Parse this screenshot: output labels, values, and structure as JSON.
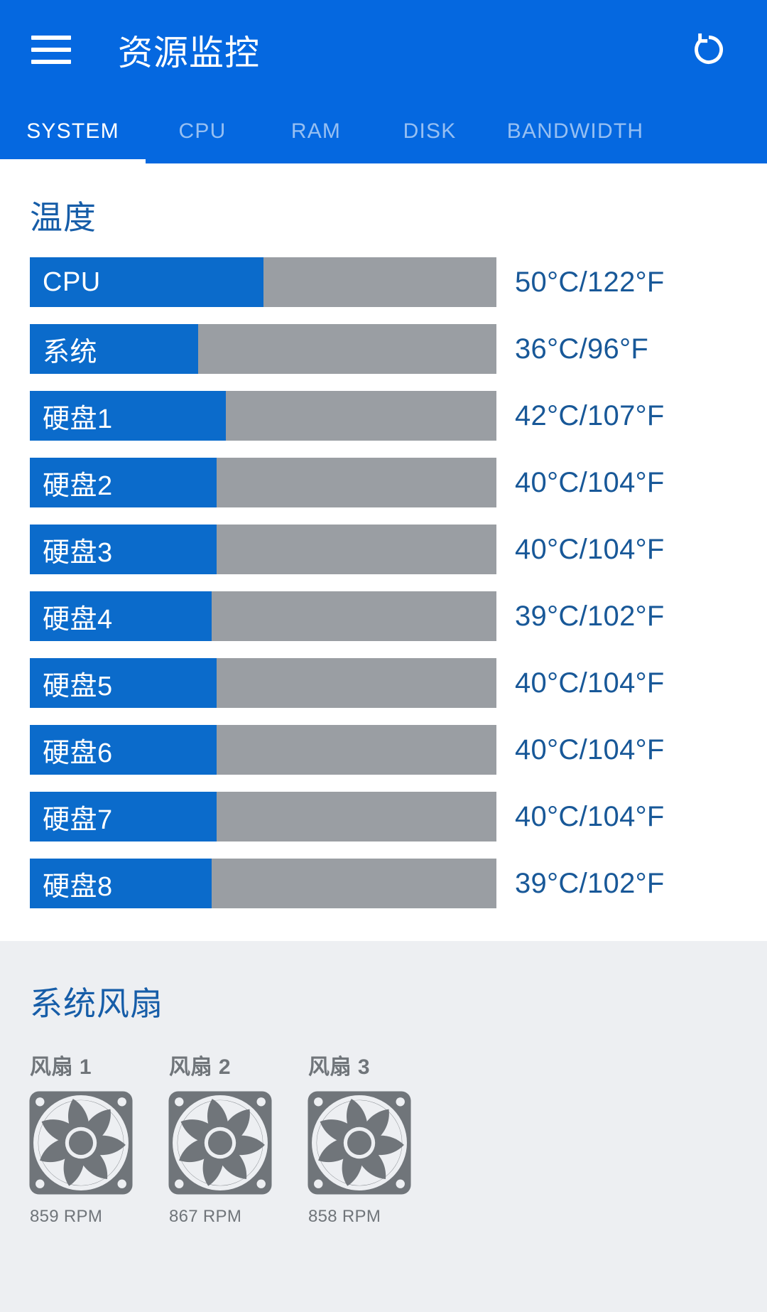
{
  "appbar": {
    "title": "资源监控",
    "menu_icon": "hamburger-menu-icon",
    "refresh_icon": "refresh-icon"
  },
  "tabs": [
    {
      "label": "SYSTEM",
      "active": true
    },
    {
      "label": "CPU",
      "active": false
    },
    {
      "label": "RAM",
      "active": false
    },
    {
      "label": "DISK",
      "active": false
    },
    {
      "label": "BANDWIDTH",
      "active": false
    }
  ],
  "temperature": {
    "heading": "温度",
    "rows": [
      {
        "label": "CPU",
        "value": "50°C/122°F",
        "celsius": 50,
        "fill_pct": 50
      },
      {
        "label": "系统",
        "value": "36°C/96°F",
        "celsius": 36,
        "fill_pct": 36
      },
      {
        "label": "硬盘1",
        "value": "42°C/107°F",
        "celsius": 42,
        "fill_pct": 42
      },
      {
        "label": "硬盘2",
        "value": "40°C/104°F",
        "celsius": 40,
        "fill_pct": 40
      },
      {
        "label": "硬盘3",
        "value": "40°C/104°F",
        "celsius": 40,
        "fill_pct": 40
      },
      {
        "label": "硬盘4",
        "value": "39°C/102°F",
        "celsius": 39,
        "fill_pct": 39
      },
      {
        "label": "硬盘5",
        "value": "40°C/104°F",
        "celsius": 40,
        "fill_pct": 40
      },
      {
        "label": "硬盘6",
        "value": "40°C/104°F",
        "celsius": 40,
        "fill_pct": 40
      },
      {
        "label": "硬盘7",
        "value": "40°C/104°F",
        "celsius": 40,
        "fill_pct": 40
      },
      {
        "label": "硬盘8",
        "value": "39°C/102°F",
        "celsius": 39,
        "fill_pct": 39
      }
    ]
  },
  "fans": {
    "heading": "系统风扇",
    "items": [
      {
        "name": "风扇 1",
        "rpm": "859 RPM",
        "icon": "fan-icon"
      },
      {
        "name": "风扇 2",
        "rpm": "867 RPM",
        "icon": "fan-icon"
      },
      {
        "name": "风扇 3",
        "rpm": "858 RPM",
        "icon": "fan-icon"
      }
    ]
  },
  "colors": {
    "appbar_blue": "#0568E0",
    "bar_blue": "#0B6BCB",
    "bar_track_gray": "#9A9EA3",
    "heading_blue": "#165DA8",
    "value_blue": "#185898",
    "fan_section_bg": "#EDEFF2",
    "fan_gray": "#70757A"
  }
}
